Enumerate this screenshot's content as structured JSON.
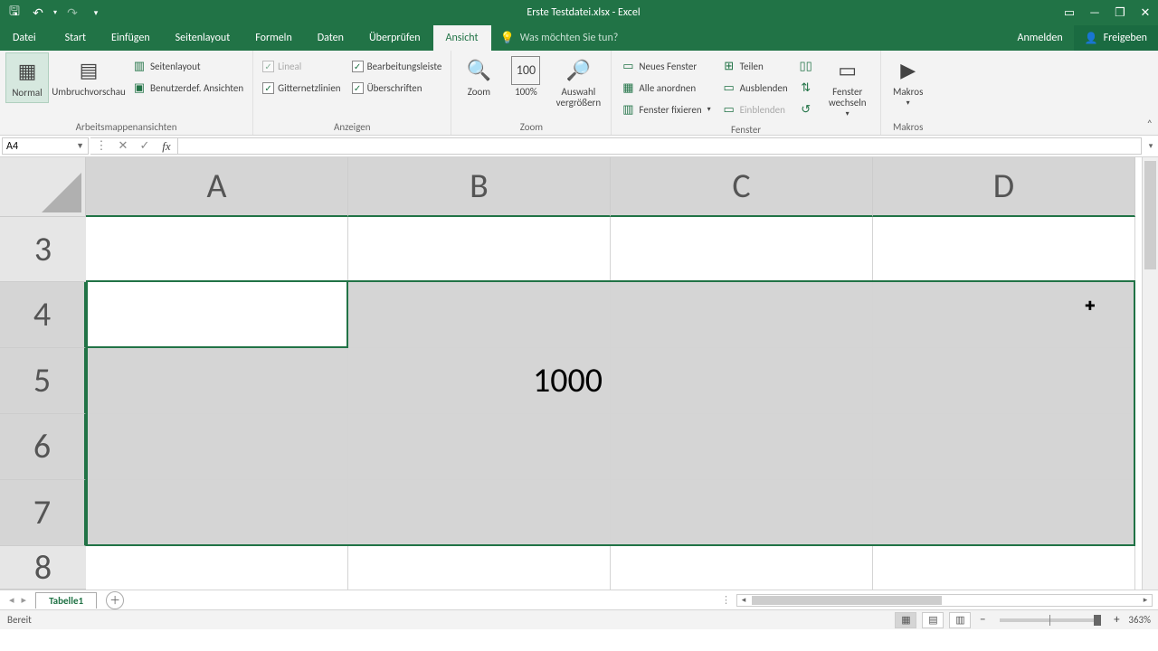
{
  "title": "Erste Testdatei.xlsx - Excel",
  "qat": {
    "save": "💾",
    "undo": "↶",
    "redo": "↷"
  },
  "tabs": {
    "file": "Datei",
    "items": [
      "Start",
      "Einfügen",
      "Seitenlayout",
      "Formeln",
      "Daten",
      "Überprüfen",
      "Ansicht"
    ],
    "active": "Ansicht",
    "tell_me": "Was möchten Sie tun?",
    "signin": "Anmelden",
    "share": "Freigeben"
  },
  "ribbon": {
    "views": {
      "normal": "Normal",
      "umbruch": "Umbruchvorschau",
      "seitenlayout": "Seitenlayout",
      "benutzerdef": "Benutzerdef. Ansichten",
      "group": "Arbeitsmappenansichten"
    },
    "anzeigen": {
      "lineal": "Lineal",
      "bearbeitungsleiste": "Bearbeitungsleiste",
      "gitternetzlinien": "Gitternetzlinien",
      "ueberschriften": "Überschriften",
      "group": "Anzeigen"
    },
    "zoom": {
      "zoom": "Zoom",
      "p100": "100%",
      "auswahl": "Auswahl vergrößern",
      "group": "Zoom"
    },
    "fenster": {
      "neues": "Neues Fenster",
      "alle": "Alle anordnen",
      "fixieren": "Fenster fixieren",
      "teilen": "Teilen",
      "ausblenden": "Ausblenden",
      "einblenden": "Einblenden",
      "wechseln": "Fenster wechseln",
      "group": "Fenster"
    },
    "makros": {
      "makros": "Makros",
      "group": "Makros"
    }
  },
  "namebox": "A4",
  "formula": "",
  "columns": [
    "A",
    "B",
    "C",
    "D"
  ],
  "rows": [
    "3",
    "4",
    "5",
    "6",
    "7",
    "8"
  ],
  "cells": {
    "B5": "1000"
  },
  "sheet": {
    "name": "Tabelle1"
  },
  "status": {
    "ready": "Bereit",
    "zoom": "363%"
  }
}
